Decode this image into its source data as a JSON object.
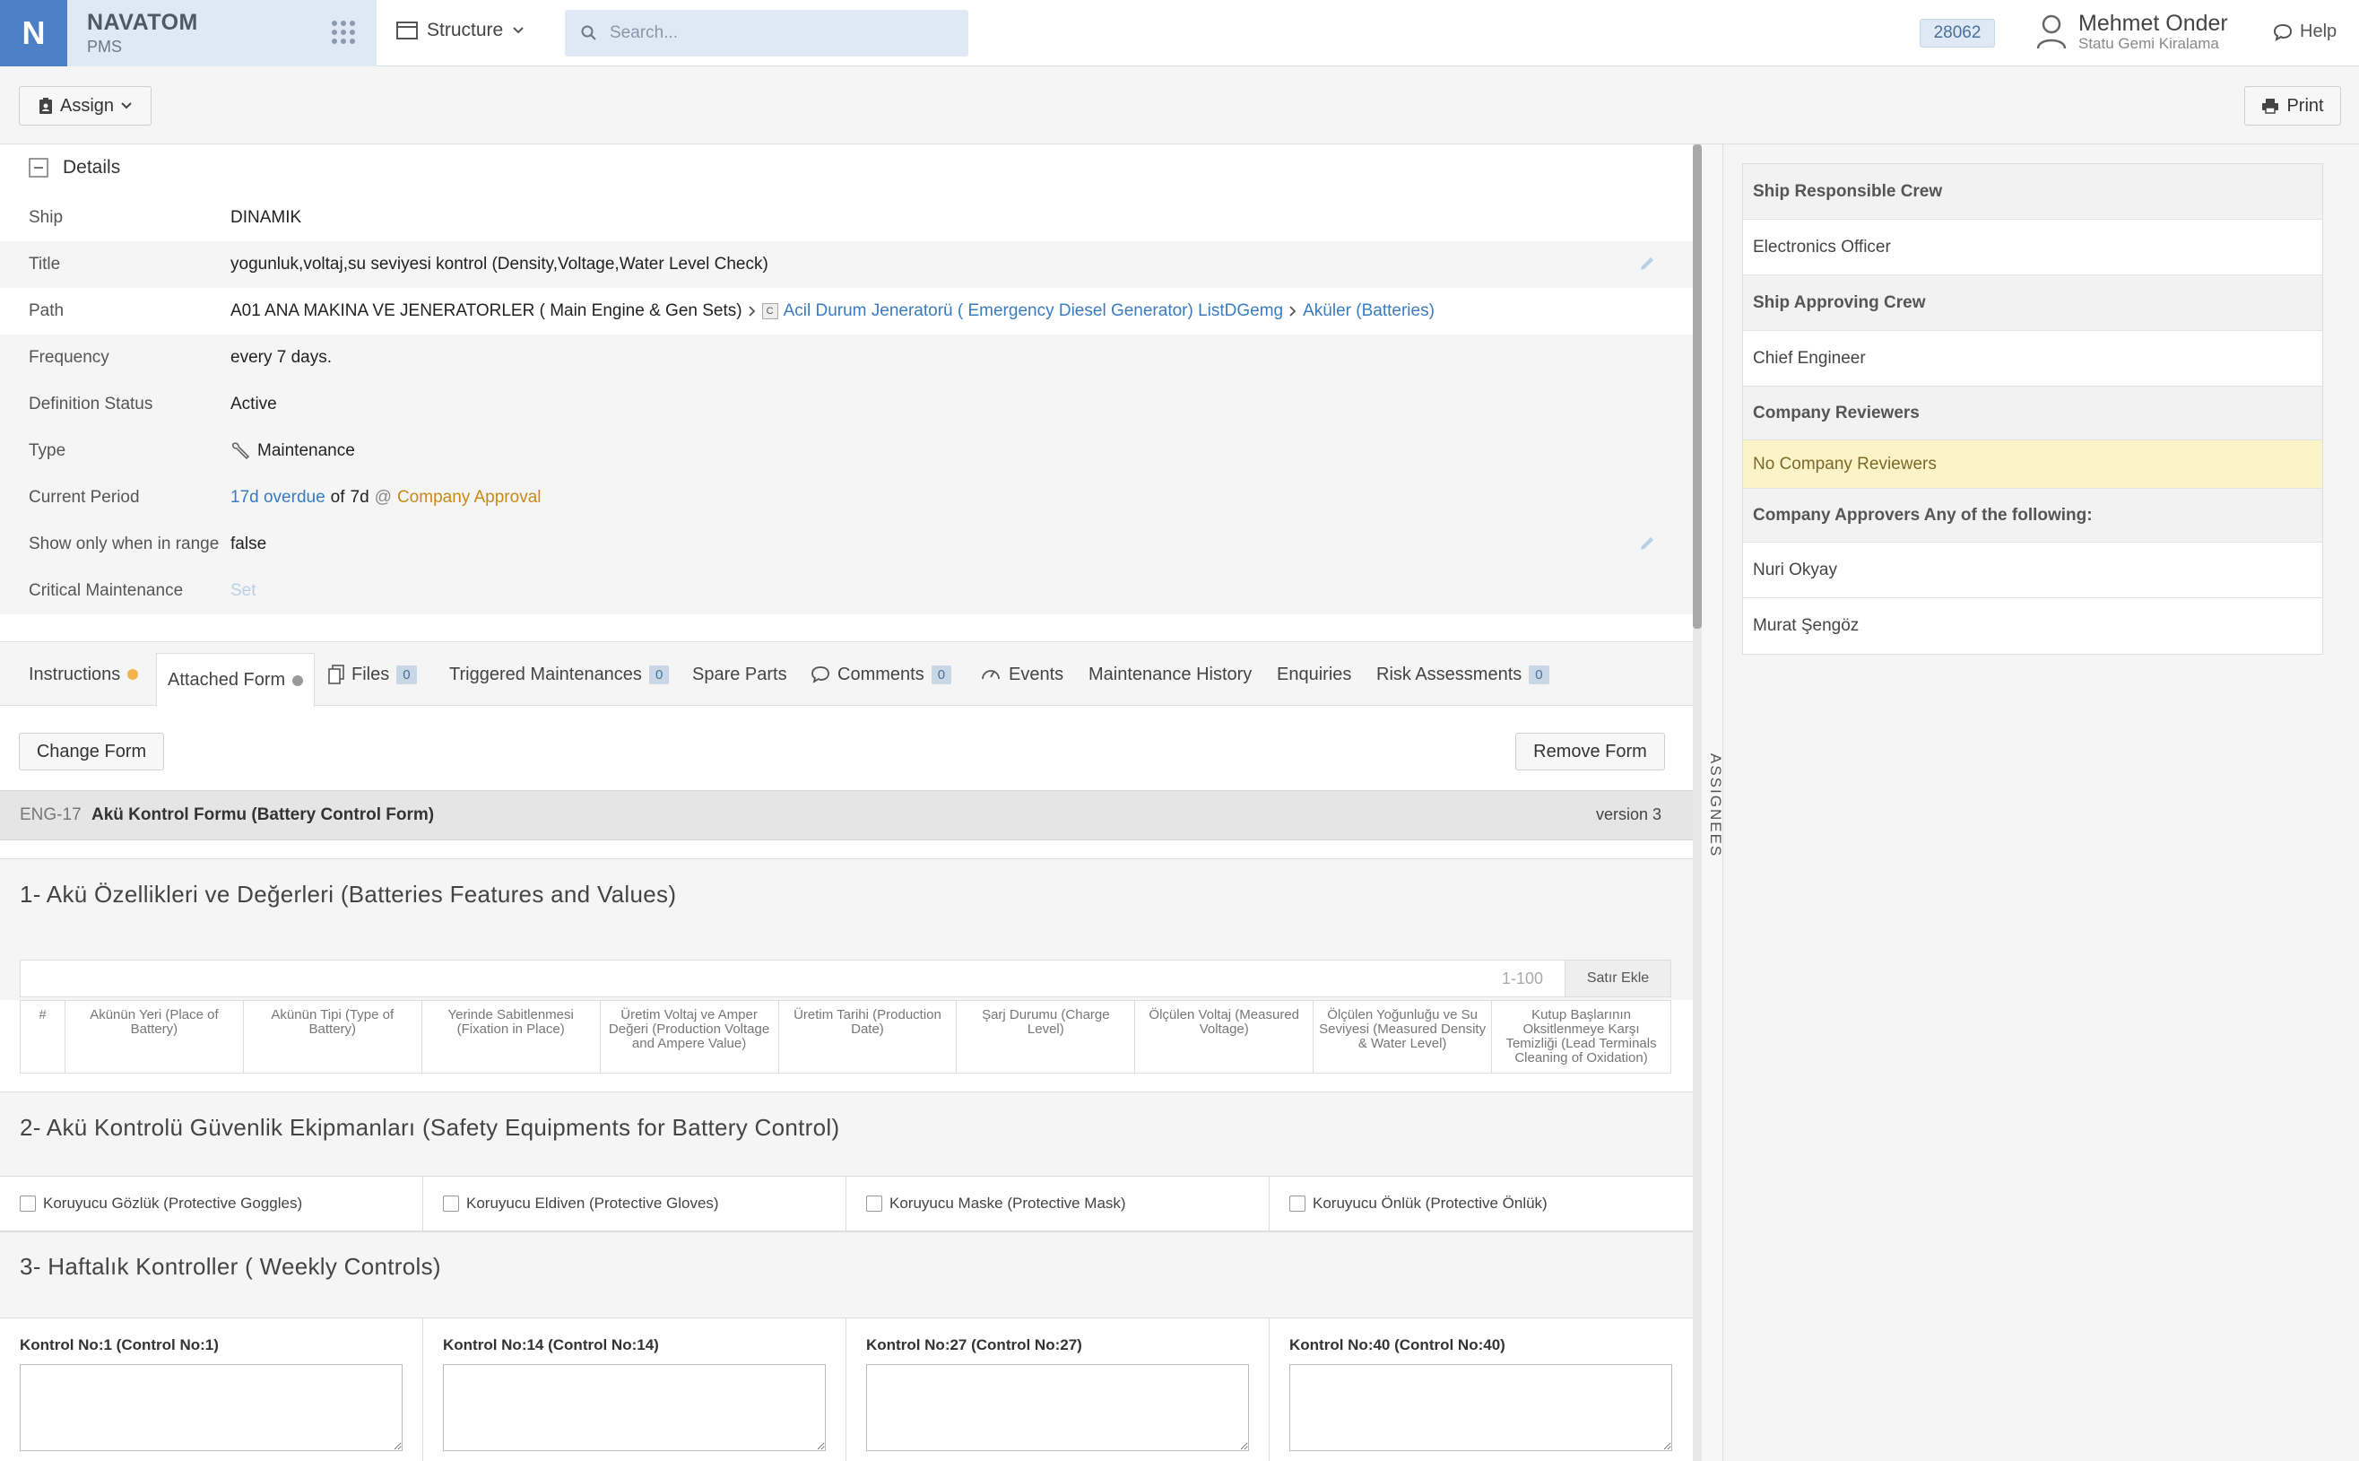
{
  "topbar": {
    "logo_letter": "N",
    "brand_name": "NAVATOM",
    "brand_sub": "PMS",
    "structure_label": "Structure",
    "search_placeholder": "Search...",
    "badge": "28062",
    "user_name": "Mehmet Onder",
    "user_org": "Statu Gemi Kiralama",
    "help_label": "Help"
  },
  "toolbar": {
    "assign_label": "Assign",
    "print_label": "Print"
  },
  "details": {
    "heading": "Details",
    "rows": [
      {
        "label": "Ship",
        "value": "DINAMIK"
      },
      {
        "label": "Title",
        "value": "yogunluk,voltaj,su seviyesi kontrol (Density,Voltage,Water Level Check)"
      },
      {
        "label": "Path",
        "value_main": "A01 ANA MAKINA VE JENERATORLER ( Main Engine & Gen Sets)",
        "path_c": "C",
        "path_link1": "Acil Durum Jeneratorü ( Emergency Diesel Generator) ListDGemg",
        "path_link2": "Aküler (Batteries)"
      },
      {
        "label": "Frequency",
        "value": "every 7 days."
      },
      {
        "label": "Definition Status",
        "value": "Active"
      },
      {
        "label": "Type",
        "value": "Maintenance"
      },
      {
        "label": "Current Period",
        "overdue": "17d overdue",
        "of_text": "of",
        "period": "7d",
        "at_text": "@",
        "stage": "Company Approval"
      },
      {
        "label": "Show only when in range",
        "value": "false"
      },
      {
        "label": "Critical Maintenance",
        "value": "Set"
      }
    ]
  },
  "tabs": [
    {
      "label": "Instructions",
      "dot": "#f0b54b"
    },
    {
      "label": "Attached Form",
      "dot": "#999999"
    },
    {
      "label": "Files",
      "count": "0"
    },
    {
      "label": "Triggered Maintenances",
      "count": "0"
    },
    {
      "label": "Spare Parts"
    },
    {
      "label": "Comments",
      "count": "0"
    },
    {
      "label": "Events"
    },
    {
      "label": "Maintenance History"
    },
    {
      "label": "Enquiries"
    },
    {
      "label": "Risk Assessments",
      "count": "0"
    }
  ],
  "form_actions": {
    "change": "Change Form",
    "remove": "Remove Form"
  },
  "form": {
    "code": "ENG-17",
    "name": "Akü Kontrol Formu (Battery Control Form)",
    "version": "version 3",
    "section1": "1- Akü Özellikleri ve Değerleri (Batteries Features and Values)",
    "range": "1-100",
    "add_row": "Satır Ekle",
    "columns": [
      "#",
      "Akünün Yeri (Place of Battery)",
      "Akünün Tipi (Type of Battery)",
      "Yerinde Sabitlenmesi (Fixation in Place)",
      "Üretim Voltaj ve Amper Değeri (Production Voltage and Ampere Value)",
      "Üretim Tarihi (Production Date)",
      "Şarj Durumu (Charge Level)",
      "Ölçülen Voltaj (Measured Voltage)",
      "Ölçülen Yoğunluğu ve Su Seviyesi (Measured Density & Water Level)",
      "Kutup Başlarının Oksitlenmeye Karşı Temizliği (Lead Terminals Cleaning of Oxidation)"
    ],
    "section2": "2- Akü Kontrolü Güvenlik Ekipmanları (Safety Equipments for Battery Control)",
    "checkboxes": [
      "Koruyucu Gözlük (Protective Goggles)",
      "Koruyucu Eldiven (Protective Gloves)",
      "Koruyucu Maske (Protective Mask)",
      "Koruyucu Önlük (Protective Önlük)"
    ],
    "section3": "3- Haftalık Kontroller ( Weekly Controls)",
    "controls": [
      "Kontrol No:1 (Control No:1)",
      "Kontrol No:14 (Control No:14)",
      "Kontrol No:27 (Control No:27)",
      "Kontrol No:40 (Control No:40)"
    ]
  },
  "assignees_label": "ASSIGNEES",
  "right_panel": {
    "ship_responsible_title": "Ship Responsible Crew",
    "ship_responsible": "Electronics Officer",
    "ship_approving_title": "Ship Approving Crew",
    "ship_approving": "Chief Engineer",
    "company_reviewers_title": "Company Reviewers",
    "company_reviewers_empty": "No Company Reviewers",
    "company_approvers_title": "Company Approvers Any of the following:",
    "approvers": [
      "Nuri Okyay",
      "Murat Şengöz"
    ]
  }
}
